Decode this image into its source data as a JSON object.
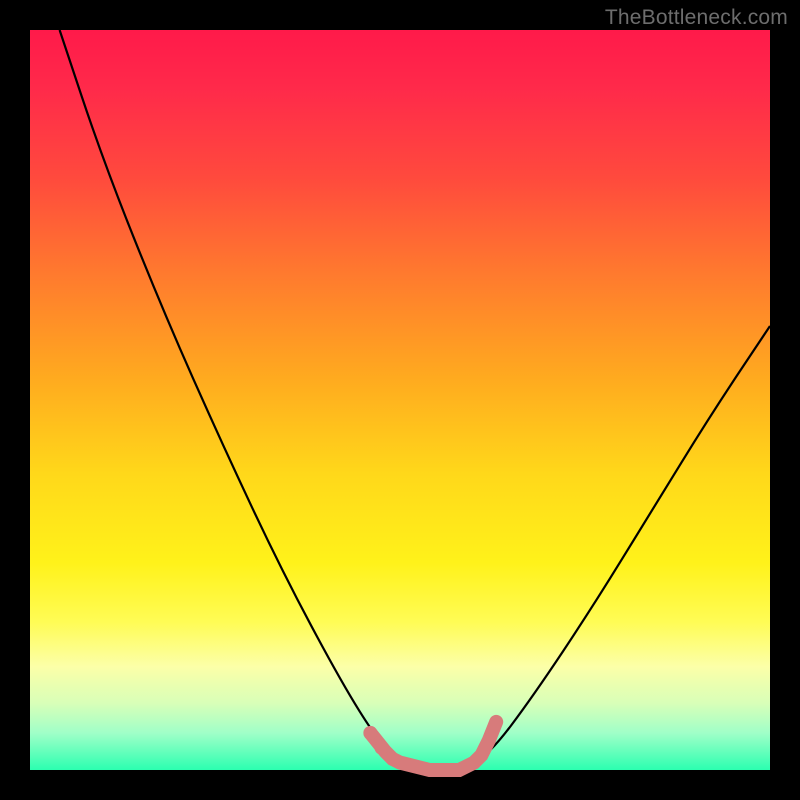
{
  "watermark": "TheBottleneck.com",
  "chart_data": {
    "type": "line",
    "title": "",
    "xlabel": "",
    "ylabel": "",
    "xlim": [
      0,
      100
    ],
    "ylim": [
      0,
      100
    ],
    "gradient_stops": [
      {
        "pos": 0,
        "color": "#ff1a4a"
      },
      {
        "pos": 8,
        "color": "#ff2a4a"
      },
      {
        "pos": 20,
        "color": "#ff4a3d"
      },
      {
        "pos": 33,
        "color": "#ff7a2e"
      },
      {
        "pos": 47,
        "color": "#ffaa1f"
      },
      {
        "pos": 60,
        "color": "#ffd81a"
      },
      {
        "pos": 72,
        "color": "#fff21a"
      },
      {
        "pos": 80,
        "color": "#fffc55"
      },
      {
        "pos": 86,
        "color": "#fcffa8"
      },
      {
        "pos": 91,
        "color": "#d8ffb8"
      },
      {
        "pos": 95,
        "color": "#a0ffc8"
      },
      {
        "pos": 100,
        "color": "#2bffb0"
      }
    ],
    "series": [
      {
        "name": "bottleneck-curve",
        "color": "#000000",
        "points": [
          {
            "x": 4,
            "y": 100
          },
          {
            "x": 10,
            "y": 82
          },
          {
            "x": 18,
            "y": 62
          },
          {
            "x": 26,
            "y": 44
          },
          {
            "x": 34,
            "y": 27
          },
          {
            "x": 42,
            "y": 12
          },
          {
            "x": 47,
            "y": 4
          },
          {
            "x": 50,
            "y": 1
          },
          {
            "x": 54,
            "y": 0
          },
          {
            "x": 58,
            "y": 0
          },
          {
            "x": 62,
            "y": 2
          },
          {
            "x": 68,
            "y": 10
          },
          {
            "x": 76,
            "y": 22
          },
          {
            "x": 84,
            "y": 35
          },
          {
            "x": 92,
            "y": 48
          },
          {
            "x": 100,
            "y": 60
          }
        ]
      },
      {
        "name": "highlight-segment",
        "color": "#d77b7b",
        "points": [
          {
            "x": 46,
            "y": 5
          },
          {
            "x": 48,
            "y": 2.5
          },
          {
            "x": 49,
            "y": 1.5
          },
          {
            "x": 50,
            "y": 1
          },
          {
            "x": 54,
            "y": 0
          },
          {
            "x": 58,
            "y": 0
          },
          {
            "x": 60,
            "y": 1
          },
          {
            "x": 61,
            "y": 2
          },
          {
            "x": 62,
            "y": 4
          },
          {
            "x": 63,
            "y": 6.5
          }
        ]
      }
    ],
    "highlight_markers": [
      {
        "x": 46,
        "y": 5
      },
      {
        "x": 47.5,
        "y": 3
      },
      {
        "x": 49,
        "y": 1.5
      }
    ]
  }
}
